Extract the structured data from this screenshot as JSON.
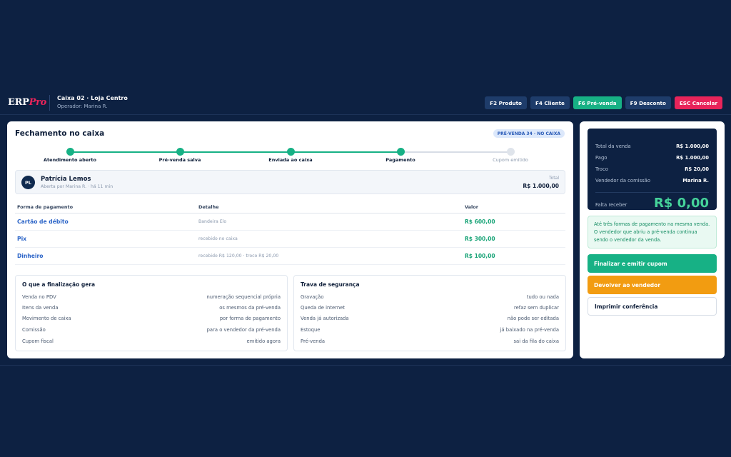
{
  "header": {
    "logo_main": "ERP",
    "logo_accent": "Pro",
    "store": "Caixa 02 · Loja Centro",
    "operator": "Operador: Marina R.",
    "fkeys": [
      {
        "label": "F2 Produto"
      },
      {
        "label": "F4 Cliente"
      },
      {
        "label": "F6 Pré-venda"
      },
      {
        "label": "F9 Desconto"
      },
      {
        "label": "ESC Cancelar"
      }
    ]
  },
  "main": {
    "title": "Fechamento no caixa",
    "badge": "PRÉ-VENDA 34 · NO CAIXA",
    "steps": [
      {
        "label": "Atendimento aberto"
      },
      {
        "label": "Pré-venda salva"
      },
      {
        "label": "Enviada ao caixa"
      },
      {
        "label": "Pagamento"
      },
      {
        "label": "Cupom emitido"
      }
    ],
    "client": {
      "initials": "PL",
      "name": "Patrícia Lemos",
      "meta": "Aberta por Marina R. · há 11 min",
      "total_label": "Total",
      "total_value": "R$ 1.000,00"
    },
    "payments": {
      "headers": [
        "Forma de pagamento",
        "Detalhe",
        "Valor"
      ],
      "rows": [
        {
          "method": "Cartão de débito",
          "detail": "Bandeira Elo",
          "value": "R$ 600,00"
        },
        {
          "method": "Pix",
          "detail": "recebido no caixa",
          "value": "R$ 300,00"
        },
        {
          "method": "Dinheiro",
          "detail": "recebido R$ 120,00 · troco R$ 20,00",
          "value": "R$ 100,00"
        }
      ]
    },
    "generates": {
      "title": "O que a finalização gera",
      "items": [
        {
          "k": "Venda no PDV",
          "v": "numeração sequencial própria"
        },
        {
          "k": "Itens da venda",
          "v": "os mesmos da pré-venda"
        },
        {
          "k": "Movimento de caixa",
          "v": "por forma de pagamento"
        },
        {
          "k": "Comissão",
          "v": "para o vendedor da pré-venda"
        },
        {
          "k": "Cupom fiscal",
          "v": "emitido agora"
        }
      ]
    },
    "security": {
      "title": "Trava de segurança",
      "items": [
        {
          "k": "Gravação",
          "v": "tudo ou nada"
        },
        {
          "k": "Queda de internet",
          "v": "refaz sem duplicar"
        },
        {
          "k": "Venda já autorizada",
          "v": "não pode ser editada"
        },
        {
          "k": "Estoque",
          "v": "já baixado na pré-venda"
        },
        {
          "k": "Pré-venda",
          "v": "sai da fila do caixa"
        }
      ]
    }
  },
  "side": {
    "summary": [
      {
        "k": "Total da venda",
        "v": "R$ 1.000,00"
      },
      {
        "k": "Pago",
        "v": "R$ 1.000,00"
      },
      {
        "k": "Troco",
        "v": "R$ 20,00"
      },
      {
        "k": "Vendedor da comissão",
        "v": "Marina R."
      }
    ],
    "falta_label": "Falta receber",
    "falta_value": "R$ 0,00",
    "note": "Até três formas de pagamento na mesma venda. O vendedor que abriu a pré-venda continua sendo o vendedor da venda.",
    "buttons": {
      "finalize": "Finalizar e emitir cupom",
      "return": "Devolver ao vendedor",
      "print": "Imprimir conferência"
    }
  },
  "colors": {
    "background": "#0d2142",
    "accent_green": "#17b185",
    "danger": "#e8245a",
    "warning": "#f29c11",
    "link_blue": "#2a63c7"
  }
}
